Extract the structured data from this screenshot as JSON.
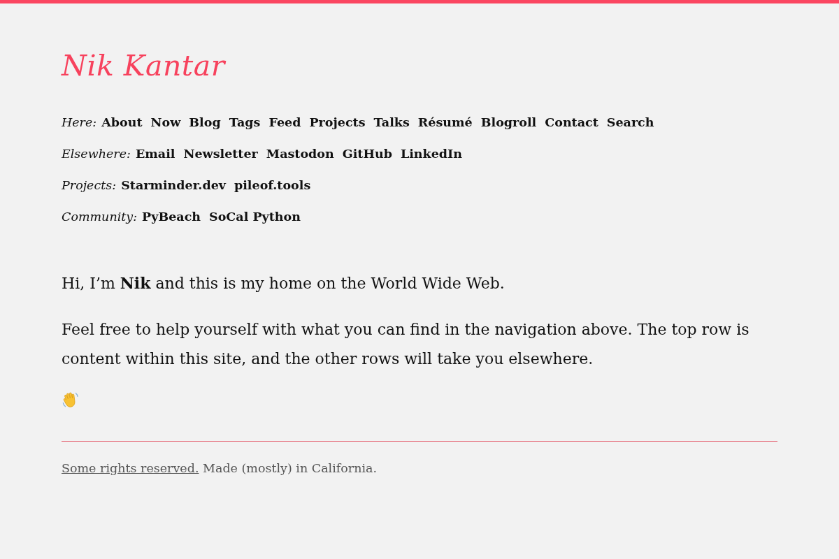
{
  "site_title": "Nik Kantar",
  "nav_rows": [
    {
      "label": "Here:",
      "links": [
        "About",
        "Now",
        "Blog",
        "Tags",
        "Feed",
        "Projects",
        "Talks",
        "Résumé",
        "Blogroll",
        "Contact",
        "Search"
      ]
    },
    {
      "label": "Elsewhere:",
      "links": [
        "Email",
        "Newsletter",
        "Mastodon",
        "GitHub",
        "LinkedIn"
      ]
    },
    {
      "label": "Projects:",
      "links": [
        "Starminder.dev",
        "pileof.tools"
      ]
    },
    {
      "label": "Community:",
      "links": [
        "PyBeach",
        "SoCal Python"
      ]
    }
  ],
  "intro": [
    "Hi, I’m **Nik** and this is my home on the World Wide Web.",
    "Feel free to help yourself with what you can find in the navigation above. The top row is content within this site, and the other rows will take you elsewhere."
  ],
  "footer": {
    "link": "Some rights reserved.",
    "text": "Made (mostly) in California."
  }
}
